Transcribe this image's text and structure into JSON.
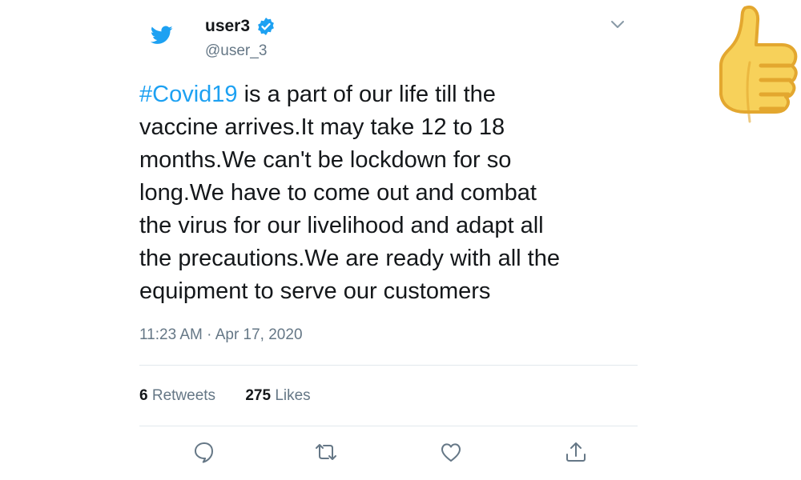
{
  "user": {
    "name": "user3",
    "handle": "@user_3"
  },
  "tweet": {
    "hashtag": "#Covid19",
    "text": " is a part of our life till the\nvaccine arrives.It  may take 12 to 18\nmonths.We can't be lockdown for so\nlong.We have to come out and combat\nthe virus for our livelihood and adapt all\nthe precautions.We are ready with all the\nequipment to serve our customers",
    "timestamp": "11:23 AM · Apr 17, 2020"
  },
  "stats": {
    "retweets_count": "6",
    "retweets_label": "Retweets",
    "likes_count": "275",
    "likes_label": "Likes"
  },
  "icons": {
    "logo": "twitter-bird-icon",
    "verified": "verified-badge-icon",
    "menu": "chevron-down-icon",
    "reply": "reply-icon",
    "retweet": "retweet-icon",
    "like": "heart-icon",
    "share": "share-icon",
    "emoji": "thumbs-up-emoji"
  },
  "colors": {
    "accent": "#1da1f2",
    "text": "#14171a",
    "secondary": "#657786",
    "divider": "#e1e8ed",
    "emoji_fill": "#f7d15a",
    "emoji_stroke": "#e3a72f"
  }
}
